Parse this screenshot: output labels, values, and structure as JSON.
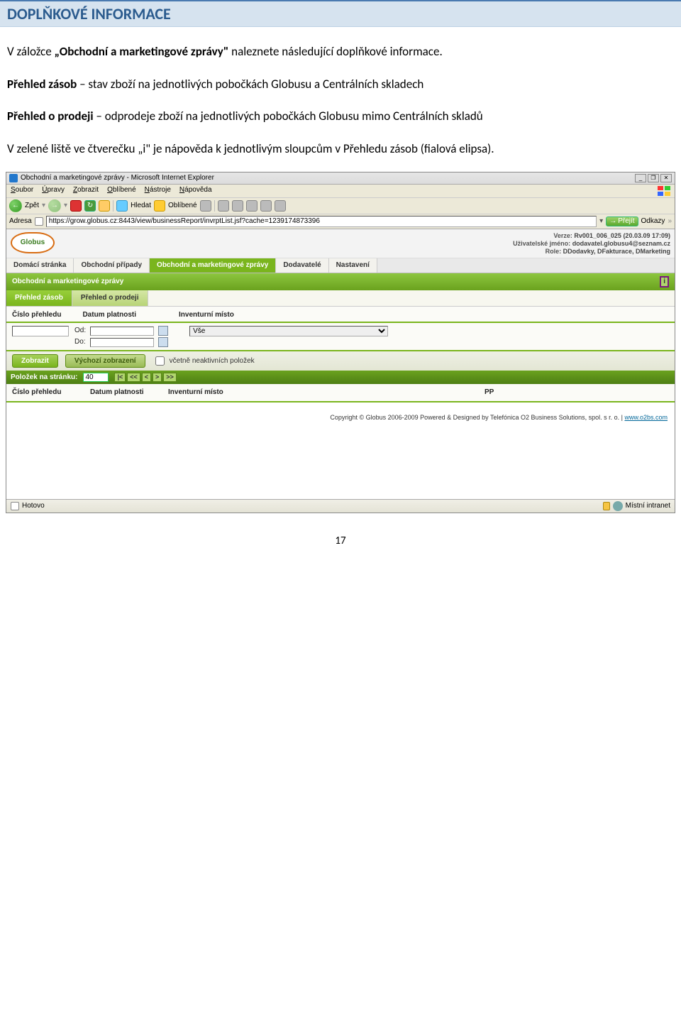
{
  "section_title": "DOPLŇKOVÉ INFORMACE",
  "intro": {
    "p1_pre": "V záložce ",
    "p1_bold": "„Obchodní a marketingové zprávy\"",
    "p1_post": " naleznete následující doplňkové informace.",
    "p2_bold": "Přehled zásob",
    "p2_rest": " – stav zboží na jednotlivých pobočkách Globusu a Centrálních skladech",
    "p3_bold": "Přehled o prodeji",
    "p3_rest": " – odprodeje zboží na jednotlivých pobočkách Globusu mimo Centrálních skladů",
    "p4": "V zelené liště ve čtverečku „i\" je nápověda k jednotlivým sloupcům v Přehledu zásob (fialová elipsa)."
  },
  "ie": {
    "title": "Obchodní a marketingové zprávy - Microsoft Internet Explorer",
    "menus": [
      "Soubor",
      "Úpravy",
      "Zobrazit",
      "Oblíbené",
      "Nástroje",
      "Nápověda"
    ],
    "btn_back": "Zpět",
    "btn_search": "Hledat",
    "btn_fav": "Oblíbené",
    "addr_label": "Adresa",
    "url": "https://grow.globus.cz:8443/view/businessReport/invrptList.jsf?cache=1239174873396",
    "go": "Přejít",
    "links": "Odkazy"
  },
  "header": {
    "logo": "Globus",
    "version_lbl": "Verze:",
    "version_val": "Rv001_006_025 (20.03.09 17:09)",
    "user_lbl": "Uživatelské jméno:",
    "user_val": "dodavatel.globusu4@seznam.cz",
    "role_lbl": "Role:",
    "role_val": "DDodavky, DFakturace, DMarketing"
  },
  "main_tabs": [
    "Domácí stránka",
    "Obchodní případy",
    "Obchodní a marketingové zprávy",
    "Dodavatelé",
    "Nastavení"
  ],
  "green_bar_title": "Obchodní a marketingové zprávy",
  "help_icon": "i",
  "sub_tabs": [
    "Přehled zásob",
    "Přehled o prodeji"
  ],
  "filter": {
    "col1": "Číslo přehledu",
    "col2": "Datum platnosti",
    "col3": "Inventurní místo",
    "od": "Od:",
    "do": "Do:",
    "inv_option": "Vše"
  },
  "actions": {
    "show": "Zobrazit",
    "default": "Výchozí zobrazení",
    "chk": "včetně neaktivních položek"
  },
  "pager": {
    "label": "Položek na stránku:",
    "value": "40",
    "btns": [
      "|<",
      "<<",
      "<",
      ">",
      ">>"
    ]
  },
  "results_header": {
    "c1": "Číslo přehledu",
    "c2": "Datum platnosti",
    "c3": "Inventurní místo",
    "c4": "PP"
  },
  "copyright": "Copyright © Globus 2006-2009 Powered & Designed by Telefónica O2 Business Solutions, spol. s r. o. | ",
  "copyright_link": "www.o2bs.com",
  "status": {
    "ready": "Hotovo",
    "zone": "Místní intranet"
  },
  "page_number": "17"
}
